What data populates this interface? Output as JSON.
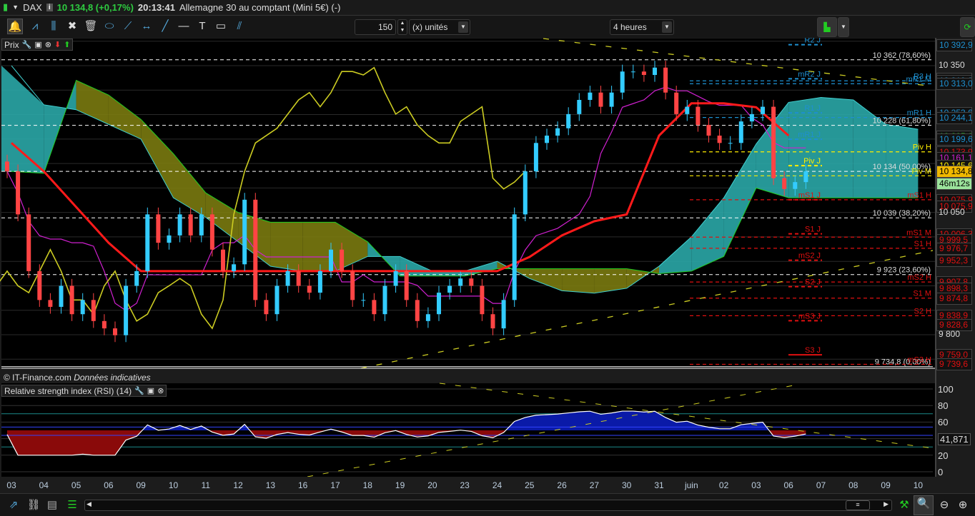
{
  "titlebar": {
    "symbol": "DAX",
    "price": "10 134,8 (+0,17%)",
    "time": "20:13:41",
    "name": "Allemagne 30 au comptant (Mini 5€) (-)"
  },
  "toolbar": {
    "units_value": "150",
    "units_label": "(x) unités",
    "period": "4 heures"
  },
  "price_panel": {
    "title": "Prix",
    "footer_copyright": "© IT-Finance.com",
    "footer_note": "Données indicatives"
  },
  "rsi_panel": {
    "title": "Relative strength index (RSI) (14)",
    "current": "41,871",
    "ticks": [
      "100",
      "80",
      "60",
      "20",
      "0"
    ]
  },
  "colors": {
    "up": "#33ccff",
    "down": "#ff4444",
    "kijun": "#ff1a1a",
    "tenkan": "#d020d0",
    "chikou": "#cccc22",
    "cloud_up": "#2aa7a7",
    "cloud_down": "#7a7a10"
  },
  "chart_data": {
    "type": "candlestick",
    "title": "DAX 4 heures",
    "closes": [
      10134,
      10046,
      9930,
      9871,
      9857,
      9900,
      9842,
      9871,
      9828,
      9813,
      9799,
      9900,
      9930,
      10046,
      9988,
      10003,
      10046,
      10003,
      10046,
      9974,
      9930,
      9944,
      10076,
      9871,
      9842,
      9900,
      9930,
      9900,
      9886,
      9930,
      9974,
      9930,
      9871,
      9871,
      9842,
      9900,
      9930,
      9871,
      9828,
      9842,
      9886,
      9900,
      9915,
      9900,
      9842,
      9813,
      9871,
      10046,
      10134,
      10192,
      10207,
      10222,
      10251,
      10280,
      10295,
      10266,
      10295,
      10338,
      10338,
      10331,
      10346,
      10295,
      10251,
      10266,
      10229,
      10207,
      10192,
      10192,
      10236,
      10251,
      10266,
      10120,
      10098,
      10112,
      10134
    ],
    "ichimoku": {
      "span_a": [
        10350,
        10270,
        10260,
        10230,
        10200,
        10080,
        10040,
        9990,
        9940,
        9930,
        9930,
        9960,
        9960,
        9930,
        9930,
        9950,
        9915,
        9890,
        9885,
        9895,
        9940,
        10000,
        10080,
        10190,
        10275,
        10285,
        10280,
        10230,
        10220
      ],
      "span_b": [
        10134,
        10130,
        10320,
        10290,
        10240,
        10170,
        10090,
        10050,
        10030,
        10030,
        10030,
        9990,
        9920,
        9920,
        9920,
        9935,
        9935,
        9935,
        9935,
        9935,
        9925,
        9930,
        9960,
        10100,
        10080,
        10080,
        10080,
        10080,
        10080
      ],
      "kijun": [
        10192,
        10134,
        10061,
        9988,
        9930,
        9930,
        9930,
        9930,
        9930,
        9930,
        9930,
        9930,
        9930,
        9930,
        9930,
        9930,
        9959,
        10003,
        10032,
        10046,
        10207,
        10273,
        10273,
        10265,
        10207
      ]
    },
    "fib_levels": [
      {
        "price": 10362,
        "label": "10 362 (78,60%)"
      },
      {
        "price": 10228,
        "label": "10 228 (61,80%)"
      },
      {
        "price": 10134,
        "label": "10 134 (50,00%)"
      },
      {
        "price": 10039,
        "label": "10 039 (38,20%)"
      },
      {
        "price": 9923,
        "label": "9 923 (23,60%)"
      },
      {
        "price": 9734.8,
        "label": "9 734,8 (0,00%)"
      }
    ],
    "pivots": [
      {
        "label": "R2 J",
        "price": 10392.9,
        "color": "#1e90d0",
        "span": "short"
      },
      {
        "label": "mR2 J",
        "price": 10323.2,
        "color": "#1e90d0",
        "span": "short"
      },
      {
        "label": "R3 H",
        "price": 10319,
        "color": "#1e90d0",
        "span": "full"
      },
      {
        "label": "mR1 M",
        "price": 10313,
        "color": "#1e90d0",
        "span": "full"
      },
      {
        "label": "R1 J",
        "price": 10253.6,
        "color": "#1e90d0",
        "span": "short"
      },
      {
        "label": "mR1 H",
        "price": 10244.1,
        "color": "#1e90d0",
        "span": "full"
      },
      {
        "label": "mR1 J",
        "price": 10199.6,
        "color": "#1e90d0",
        "span": "short"
      },
      {
        "label": "Piv H",
        "price": 10173.9,
        "color": "#ffee00",
        "span": "full"
      },
      {
        "label": "Piv J",
        "price": 10145.6,
        "color": "#ffee00",
        "span": "short"
      },
      {
        "label": "Piv M",
        "price": 10124.9,
        "color": "#ffee00",
        "span": "full"
      },
      {
        "label": "mS1 J",
        "price": 10075.9,
        "color": "#e01010",
        "span": "short"
      },
      {
        "label": "mS1 H",
        "price": 10075.9,
        "color": "#e01010",
        "span": "full"
      },
      {
        "label": "S1 J",
        "price": 10006.3,
        "color": "#e01010",
        "span": "short"
      },
      {
        "label": "mS1 M",
        "price": 9999.5,
        "color": "#e01010",
        "span": "full"
      },
      {
        "label": "S1 H",
        "price": 9976.7,
        "color": "#e01010",
        "span": "full"
      },
      {
        "label": "mS2 J",
        "price": 9952.3,
        "color": "#e01010",
        "span": "short"
      },
      {
        "label": "mS2 H",
        "price": 9907.8,
        "color": "#e01010",
        "span": "full"
      },
      {
        "label": "S2 J",
        "price": 9898.3,
        "color": "#e01010",
        "span": "short"
      },
      {
        "label": "S1 M",
        "price": 9874.8,
        "color": "#e01010",
        "span": "full"
      },
      {
        "label": "S2 H",
        "price": 9838.9,
        "color": "#e01010",
        "span": "full"
      },
      {
        "label": "mS3 J",
        "price": 9828.6,
        "color": "#e01010",
        "span": "short"
      },
      {
        "label": "S3 J",
        "price": 9759.0,
        "color": "#e01010",
        "span": "short"
      },
      {
        "label": "mS3 H",
        "price": 9739.6,
        "color": "#e01010",
        "span": "full"
      }
    ],
    "axis_labels": [
      {
        "text": "10 392,9",
        "price": 10392.9,
        "color": "#1e90d0"
      },
      {
        "text": "10 350",
        "price": 10350,
        "color": "#dddddd",
        "plain": true
      },
      {
        "text": "10 323,2",
        "price": 10323.2,
        "color": "#1e90d0"
      },
      {
        "text": "10 319,0",
        "price": 10319,
        "color": "#1e90d0"
      },
      {
        "text": "10 313,0",
        "price": 10313,
        "color": "#1e90d0"
      },
      {
        "text": "10 253,6",
        "price": 10253.6,
        "color": "#1e90d0"
      },
      {
        "text": "10 244,1",
        "price": 10244.1,
        "color": "#1e90d0"
      },
      {
        "text": "10 205,6",
        "price": 10205.6,
        "color": "#22dd22"
      },
      {
        "text": "10 199,6",
        "price": 10199.6,
        "color": "#1e90d0"
      },
      {
        "text": "10 173,9",
        "price": 10173.9,
        "color": "#e01010"
      },
      {
        "text": "10 161,1",
        "price": 10161.1,
        "color": "#d020d0"
      },
      {
        "text": "10 145,6",
        "price": 10145.6,
        "color": "#ffee00"
      },
      {
        "text": "10 124,9",
        "price": 10124.9,
        "color": "#ffee00"
      },
      {
        "text": "10 134,8",
        "price": 10134.8,
        "color": "#000000",
        "bg": "#f0b800"
      },
      {
        "text": "46m12s",
        "price": 10110,
        "color": "#000000",
        "bg": "#9be39b"
      },
      {
        "text": "10 075,9",
        "price": 10075.9,
        "color": "#e01010"
      },
      {
        "text": "10 075,9",
        "price": 10062,
        "color": "#e01010"
      },
      {
        "text": "10 050",
        "price": 10050,
        "color": "#dddddd",
        "plain": true
      },
      {
        "text": "10 006,3",
        "price": 10006.3,
        "color": "#e01010"
      },
      {
        "text": "9 999,5",
        "price": 9994,
        "color": "#e01010"
      },
      {
        "text": "9 976,7",
        "price": 9976.7,
        "color": "#e01010"
      },
      {
        "text": "9 952,3",
        "price": 9952.3,
        "color": "#e01010"
      },
      {
        "text": "9 907,8",
        "price": 9907.8,
        "color": "#e01010"
      },
      {
        "text": "9 898,3",
        "price": 9895,
        "color": "#e01010"
      },
      {
        "text": "9 874,8",
        "price": 9874.8,
        "color": "#e01010"
      },
      {
        "text": "9 838,9",
        "price": 9838.9,
        "color": "#e01010"
      },
      {
        "text": "9 828,6",
        "price": 9821,
        "color": "#e01010"
      },
      {
        "text": "9 800",
        "price": 9800,
        "color": "#dddddd",
        "plain": true
      },
      {
        "text": "9 759,0",
        "price": 9759,
        "color": "#e01010"
      },
      {
        "text": "9 739,6",
        "price": 9739.6,
        "color": "#e01010"
      }
    ],
    "x_ticks": [
      "03",
      "04",
      "05",
      "06",
      "09",
      "10",
      "11",
      "12",
      "13",
      "16",
      "17",
      "18",
      "19",
      "20",
      "23",
      "24",
      "25",
      "26",
      "27",
      "30",
      "31",
      "juin",
      "02",
      "03",
      "06",
      "07",
      "08",
      "09",
      "10"
    ],
    "ylim": [
      9720,
      10420
    ]
  }
}
